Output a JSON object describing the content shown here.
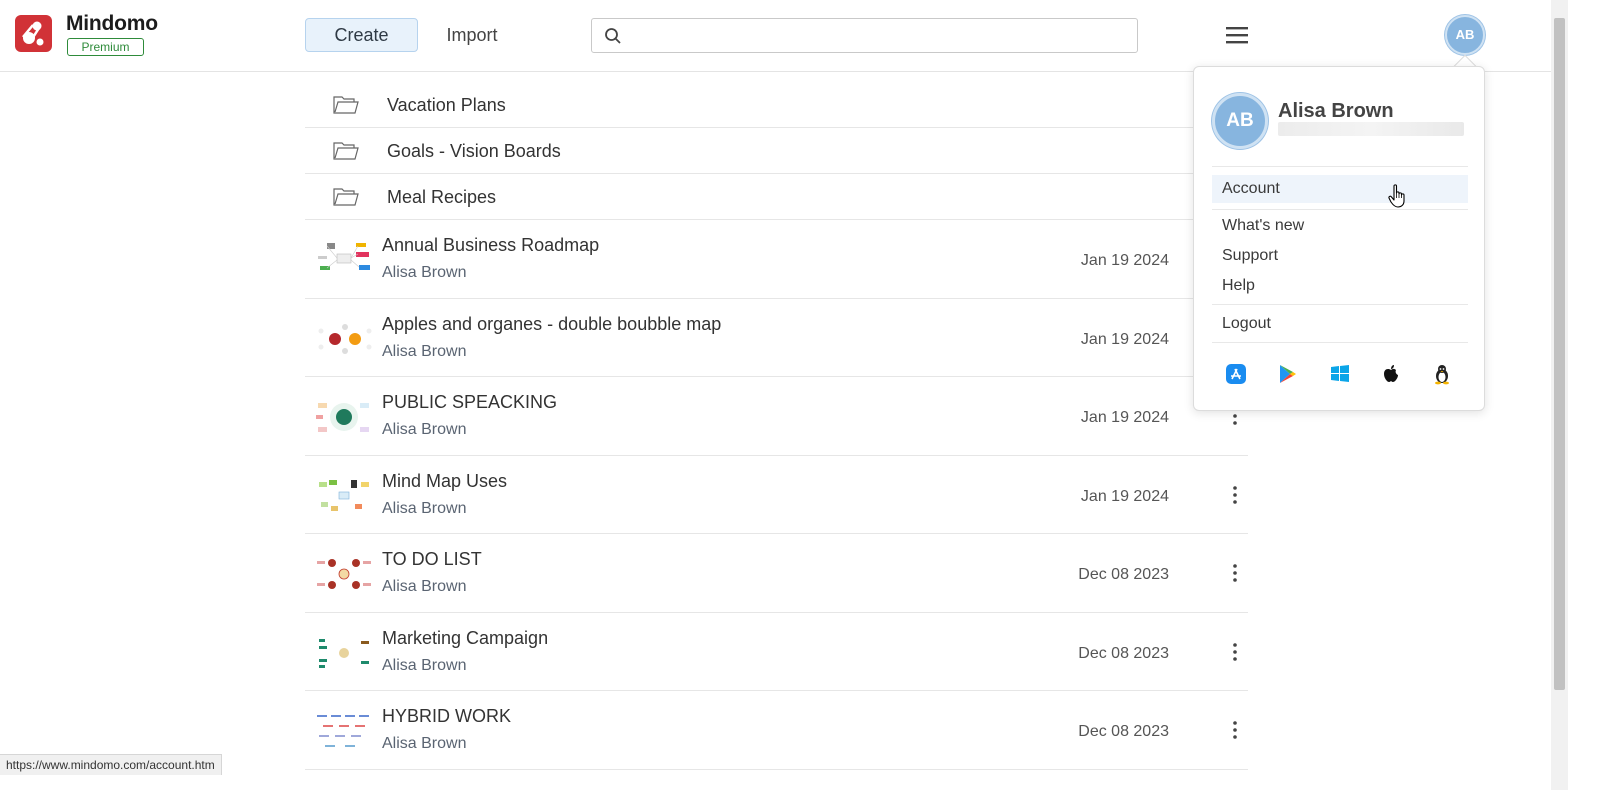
{
  "header": {
    "brand": "Mindomo",
    "badge": "Premium",
    "create_label": "Create",
    "import_label": "Import",
    "search_placeholder": "",
    "avatar_initials": "AB",
    "brand_color": "#d13237"
  },
  "folders": [
    {
      "name": "Vacation Plans"
    },
    {
      "name": "Goals - Vision Boards"
    },
    {
      "name": "Meal Recipes"
    }
  ],
  "maps": [
    {
      "title": "Annual Business Roadmap",
      "owner": "Alisa Brown",
      "date": "Jan 19 2024"
    },
    {
      "title": "Apples and organes - double boubble map",
      "owner": "Alisa Brown",
      "date": "Jan 19 2024"
    },
    {
      "title": "PUBLIC SPEACKING",
      "owner": "Alisa Brown",
      "date": "Jan 19 2024"
    },
    {
      "title": "Mind Map Uses",
      "owner": "Alisa Brown",
      "date": "Jan 19 2024"
    },
    {
      "title": "TO DO LIST",
      "owner": "Alisa Brown",
      "date": "Dec 08 2023"
    },
    {
      "title": "Marketing Campaign",
      "owner": "Alisa Brown",
      "date": "Dec 08 2023"
    },
    {
      "title": "HYBRID WORK",
      "owner": "Alisa Brown",
      "date": "Dec 08 2023"
    }
  ],
  "account_menu": {
    "initials": "AB",
    "name": "Alisa Brown",
    "items": [
      {
        "label": "Account"
      },
      {
        "label": "What's new"
      },
      {
        "label": "Support"
      },
      {
        "label": "Help"
      },
      {
        "label": "Logout"
      }
    ],
    "platforms": [
      "app-store-icon",
      "google-play-icon",
      "windows-icon",
      "apple-icon",
      "linux-icon"
    ]
  },
  "status_bar": {
    "url": "https://www.mindomo.com/account.htm"
  }
}
